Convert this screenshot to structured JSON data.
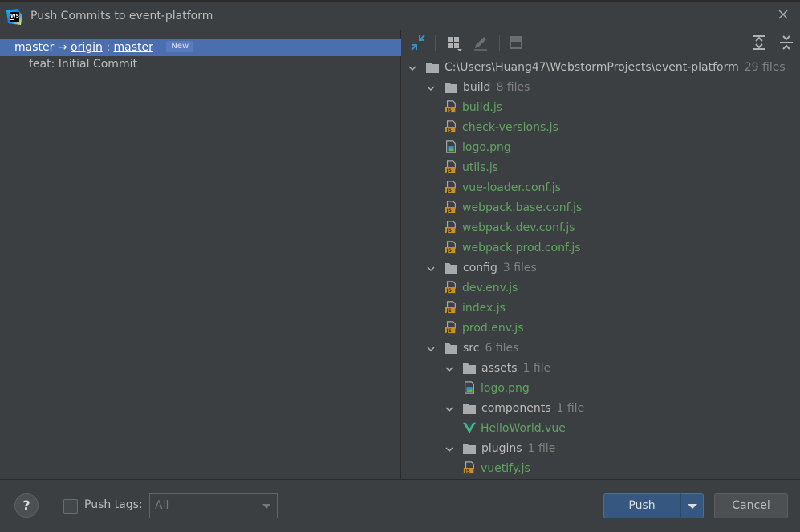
{
  "window": {
    "title": "Push Commits to event-platform",
    "app_icon": "webstorm-icon",
    "app_icon_text": "WS"
  },
  "commits": {
    "branch_local": "master",
    "arrow": "→",
    "remote": "origin",
    "separator": ":",
    "branch_remote": "master",
    "badge": "New",
    "commit_message": "feat: Initial Commit"
  },
  "toolbar": {
    "icons": [
      "expand-collapse-arrows-icon",
      "group-by-icon",
      "edit-source-icon",
      "show-diff-icon",
      "expand-all-icon",
      "collapse-all-icon"
    ]
  },
  "tree": [
    {
      "type": "dir",
      "depth": 0,
      "label": "C:\\Users\\Huang47\\WebstormProjects\\event-platform",
      "count": "29 files"
    },
    {
      "type": "dir",
      "depth": 1,
      "label": "build",
      "count": "8 files"
    },
    {
      "type": "file",
      "kind": "js",
      "depth": 2,
      "label": "build.js"
    },
    {
      "type": "file",
      "kind": "js",
      "depth": 2,
      "label": "check-versions.js"
    },
    {
      "type": "file",
      "kind": "png",
      "depth": 2,
      "label": "logo.png"
    },
    {
      "type": "file",
      "kind": "js",
      "depth": 2,
      "label": "utils.js"
    },
    {
      "type": "file",
      "kind": "js",
      "depth": 2,
      "label": "vue-loader.conf.js"
    },
    {
      "type": "file",
      "kind": "js",
      "depth": 2,
      "label": "webpack.base.conf.js"
    },
    {
      "type": "file",
      "kind": "js",
      "depth": 2,
      "label": "webpack.dev.conf.js"
    },
    {
      "type": "file",
      "kind": "js",
      "depth": 2,
      "label": "webpack.prod.conf.js"
    },
    {
      "type": "dir",
      "depth": 1,
      "label": "config",
      "count": "3 files"
    },
    {
      "type": "file",
      "kind": "js",
      "depth": 2,
      "label": "dev.env.js"
    },
    {
      "type": "file",
      "kind": "js",
      "depth": 2,
      "label": "index.js"
    },
    {
      "type": "file",
      "kind": "js",
      "depth": 2,
      "label": "prod.env.js"
    },
    {
      "type": "dir",
      "depth": 1,
      "label": "src",
      "count": "6 files"
    },
    {
      "type": "dir",
      "depth": 2,
      "label": "assets",
      "count": "1 file"
    },
    {
      "type": "file",
      "kind": "png",
      "depth": 3,
      "label": "logo.png"
    },
    {
      "type": "dir",
      "depth": 2,
      "label": "components",
      "count": "1 file"
    },
    {
      "type": "file",
      "kind": "vue",
      "depth": 3,
      "label": "HelloWorld.vue"
    },
    {
      "type": "dir",
      "depth": 2,
      "label": "plugins",
      "count": "1 file"
    },
    {
      "type": "file",
      "kind": "js",
      "depth": 3,
      "label": "vuetify.js"
    }
  ],
  "footer": {
    "help_label": "?",
    "push_tags_label": "Push tags:",
    "push_tags_value": "All",
    "push_label": "Push",
    "cancel_label": "Cancel"
  },
  "colors": {
    "accent_selection": "#4b6eaf",
    "file_added": "#62a362",
    "primary_button": "#365880"
  }
}
